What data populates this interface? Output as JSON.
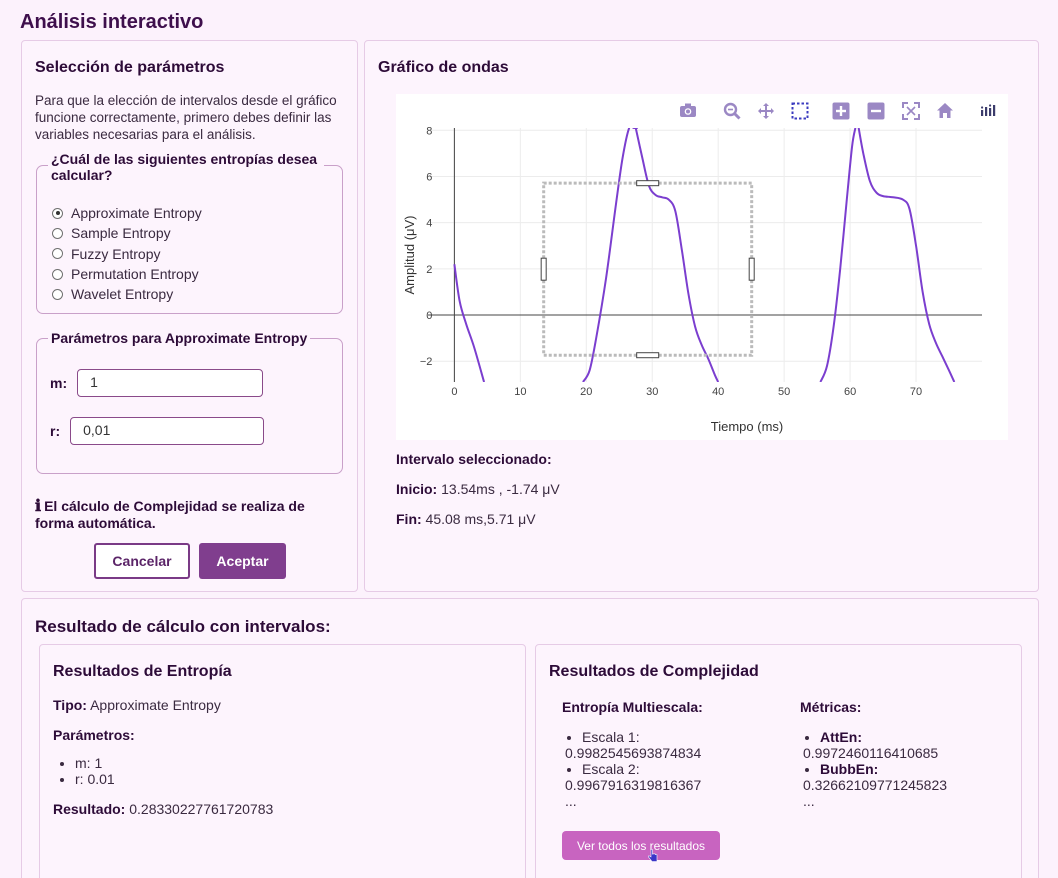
{
  "page": {
    "title": "Análisis interactivo"
  },
  "params": {
    "title": "Selección de parámetros",
    "intro": "Para que la elección de intervalos desde el gráfico funcione correctamente, primero debes definir las variables necesarias para el análisis.",
    "entropy_question": "¿Cuál de las siguientes entropías desea calcular?",
    "entropy_options": [
      "Approximate Entropy",
      "Sample Entropy",
      "Fuzzy Entropy",
      "Permutation Entropy",
      "Wavelet Entropy"
    ],
    "selected_option": "Approximate Entropy",
    "param_legend": "Parámetros para Approximate Entropy",
    "m_label": "m:",
    "m_value": "1",
    "r_label": "r:",
    "r_value": "0,01",
    "info_text": "El cálculo de Complejidad se realiza de forma automática.",
    "cancel_label": "Cancelar",
    "accept_label": "Aceptar"
  },
  "chart_panel": {
    "title": "Gráfico de ondas",
    "modebar_icons": [
      "camera-icon",
      "zoom-icon",
      "pan-icon",
      "box-select-icon",
      "zoom-in-icon",
      "zoom-out-icon",
      "autoscale-icon",
      "home-icon",
      "plotly-logo-icon"
    ],
    "interval_title": "Intervalo seleccionado:",
    "start_label": "Inicio:",
    "start_value": "13.54ms , -1.74 μV",
    "end_label": "Fin:",
    "end_value": "45.08 ms,5.71 μV"
  },
  "chart_data": {
    "type": "line",
    "xlabel": "Tiempo (ms)",
    "ylabel": "Amplitud (μV)",
    "xlim": [
      -4,
      80
    ],
    "ylim": [
      -2.9,
      8.1
    ],
    "xticks": [
      0,
      10,
      20,
      30,
      40,
      50,
      60,
      70
    ],
    "yticks": [
      -2,
      0,
      2,
      4,
      6,
      8
    ],
    "line_color": "#7b3ecf",
    "grid": true,
    "segments": [
      {
        "x": [
          0,
          0.8,
          1.8,
          3.0,
          4.5
        ],
        "y": [
          2.2,
          0.6,
          -0.4,
          -1.4,
          -2.9
        ]
      },
      {
        "x": [
          19.5,
          20.5,
          21.5,
          23.0,
          24.5,
          25.5,
          26.5,
          27.2,
          27.8
        ],
        "y": [
          -2.9,
          -2.4,
          -1.0,
          1.6,
          4.8,
          6.8,
          8.1,
          8.1,
          8.1
        ]
      },
      {
        "x": [
          27.5,
          28.5,
          29.5,
          30.5,
          31.5,
          32.5,
          33.5,
          34.5,
          35.5,
          36.5,
          37.5,
          38.5,
          39.5,
          40.0
        ],
        "y": [
          8.1,
          6.8,
          5.6,
          5.2,
          5.1,
          5.0,
          4.5,
          2.8,
          0.9,
          -0.5,
          -1.3,
          -1.9,
          -2.6,
          -2.9
        ]
      },
      {
        "x": [
          55.5,
          56.5,
          57.5,
          58.5,
          59.5,
          60.3,
          60.8
        ],
        "y": [
          -2.9,
          -2.2,
          -0.5,
          2.0,
          5.0,
          7.3,
          8.1
        ]
      },
      {
        "x": [
          61.3,
          62.0,
          63.0,
          64.0,
          65.0,
          66.5,
          68.0,
          69.0,
          70.0,
          71.0,
          72.0,
          73.0,
          74.0,
          75.0,
          75.8
        ],
        "y": [
          8.1,
          7.0,
          5.8,
          5.3,
          5.15,
          5.1,
          5.0,
          4.6,
          3.0,
          1.0,
          -0.4,
          -1.2,
          -1.8,
          -2.4,
          -2.9
        ]
      }
    ],
    "selection": {
      "x0": 13.54,
      "x1": 45.08,
      "y0": -1.74,
      "y1": 5.71
    }
  },
  "results": {
    "title": "Resultado de cálculo con intervalos:",
    "entropy": {
      "title": "Resultados de Entropía",
      "type_label": "Tipo:",
      "type_value": "Approximate Entropy",
      "params_label": "Parámetros:",
      "params": [
        "m: 1",
        "r: 0.01"
      ],
      "result_label": "Resultado:",
      "result_value": "0.28330227761720783"
    },
    "complexity": {
      "title": "Resultados de Complejidad",
      "multiscale_title": "Entropía Multiescala:",
      "scale1_label": "Escala 1:",
      "scale1_value": "0.9982545693874834",
      "scale2_label": "Escala 2:",
      "scale2_value": "0.9967916319816367",
      "ellipsis": "...",
      "metrics_title": "Métricas:",
      "atten_label": "AttEn:",
      "atten_value": "0.9972460116410685",
      "bubben_label": "BubbEn:",
      "bubben_value": "0.32662109771245823",
      "see_all_label": "Ver todos los resultados"
    }
  }
}
